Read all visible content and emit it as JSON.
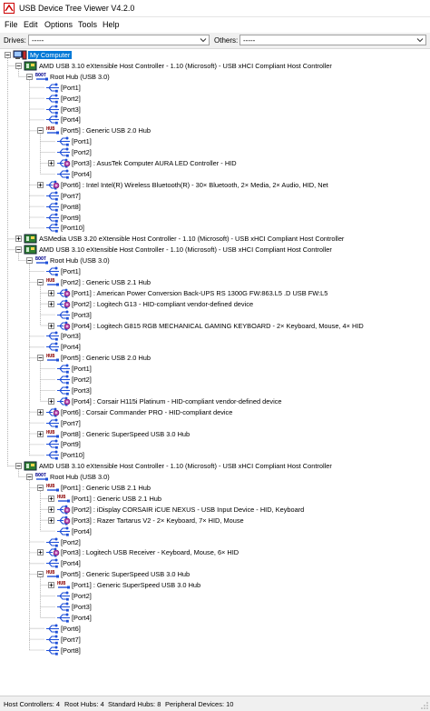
{
  "window": {
    "title": "USB Device Tree Viewer V4.2.0"
  },
  "menu": {
    "file": "File",
    "edit": "Edit",
    "options": "Options",
    "tools": "Tools",
    "help": "Help"
  },
  "toolbar": {
    "drives_label": "Drives:",
    "drives_value": "-----",
    "others_label": "Others:",
    "others_value": "-----"
  },
  "tree": [
    {
      "level": 0,
      "icon": "computer",
      "text": "My Computer",
      "exp": "minus",
      "selected": true
    },
    {
      "level": 1,
      "icon": "controller",
      "text": "AMD USB 3.10 eXtensible Host Controller - 1.10 (Microsoft) - USB xHCI Compliant Host Controller",
      "exp": "minus"
    },
    {
      "level": 2,
      "icon": "boot",
      "text": "Root Hub (USB 3.0)",
      "exp": "minus"
    },
    {
      "level": 3,
      "icon": "port",
      "text": "[Port1]"
    },
    {
      "level": 3,
      "icon": "port",
      "text": "[Port2]"
    },
    {
      "level": 3,
      "icon": "port",
      "text": "[Port3]"
    },
    {
      "level": 3,
      "icon": "port",
      "text": "[Port4]"
    },
    {
      "level": 3,
      "icon": "hub",
      "text": "[Port5] : Generic USB 2.0 Hub",
      "exp": "minus"
    },
    {
      "level": 4,
      "icon": "port",
      "text": "[Port1]"
    },
    {
      "level": 4,
      "icon": "port",
      "text": "[Port2]"
    },
    {
      "level": 4,
      "icon": "device",
      "text": "[Port3] : AsusTek Computer AURA LED Controller - HID",
      "exp": "plus"
    },
    {
      "level": 4,
      "icon": "port",
      "text": "[Port4]"
    },
    {
      "level": 3,
      "icon": "device",
      "text": "[Port6] : Intel Intel(R) Wireless Bluetooth(R) - 30× Bluetooth, 2× Media, 2× Audio, HID, Net",
      "exp": "plus"
    },
    {
      "level": 3,
      "icon": "port",
      "text": "[Port7]"
    },
    {
      "level": 3,
      "icon": "port",
      "text": "[Port8]"
    },
    {
      "level": 3,
      "icon": "port",
      "text": "[Port9]"
    },
    {
      "level": 3,
      "icon": "port",
      "text": "[Port10]"
    },
    {
      "level": 1,
      "icon": "controller",
      "text": "ASMedia USB 3.20 eXtensible Host Controller - 1.10 (Microsoft) - USB xHCI Compliant Host Controller",
      "exp": "plus"
    },
    {
      "level": 1,
      "icon": "controller",
      "text": "AMD USB 3.10 eXtensible Host Controller - 1.10 (Microsoft) - USB xHCI Compliant Host Controller",
      "exp": "minus"
    },
    {
      "level": 2,
      "icon": "boot",
      "text": "Root Hub (USB 3.0)",
      "exp": "minus"
    },
    {
      "level": 3,
      "icon": "port",
      "text": "[Port1]"
    },
    {
      "level": 3,
      "icon": "hub",
      "text": "[Port2] : Generic USB 2.1 Hub",
      "exp": "minus"
    },
    {
      "level": 4,
      "icon": "device",
      "text": "[Port1] : American Power Conversion Back-UPS RS 1300G FW:863.L5 .D USB FW:L5",
      "exp": "plus"
    },
    {
      "level": 4,
      "icon": "device",
      "text": "[Port2] : Logitech G13 - HID-compliant vendor-defined device",
      "exp": "plus"
    },
    {
      "level": 4,
      "icon": "port",
      "text": "[Port3]"
    },
    {
      "level": 4,
      "icon": "device",
      "text": "[Port4] : Logitech G815 RGB MECHANICAL GAMING KEYBOARD - 2× Keyboard, Mouse, 4× HID",
      "exp": "plus"
    },
    {
      "level": 3,
      "icon": "port",
      "text": "[Port3]"
    },
    {
      "level": 3,
      "icon": "port",
      "text": "[Port4]"
    },
    {
      "level": 3,
      "icon": "hub",
      "text": "[Port5] : Generic USB 2.0 Hub",
      "exp": "minus"
    },
    {
      "level": 4,
      "icon": "port",
      "text": "[Port1]"
    },
    {
      "level": 4,
      "icon": "port",
      "text": "[Port2]"
    },
    {
      "level": 4,
      "icon": "port",
      "text": "[Port3]"
    },
    {
      "level": 4,
      "icon": "device",
      "text": "[Port4] : Corsair H115i Platinum - HID-compliant vendor-defined device",
      "exp": "plus"
    },
    {
      "level": 3,
      "icon": "device",
      "text": "[Port6] : Corsair Commander PRO - HID-compliant device",
      "exp": "plus"
    },
    {
      "level": 3,
      "icon": "port",
      "text": "[Port7]"
    },
    {
      "level": 3,
      "icon": "hub",
      "text": "[Port8] : Generic SuperSpeed USB 3.0 Hub",
      "exp": "plus"
    },
    {
      "level": 3,
      "icon": "port",
      "text": "[Port9]"
    },
    {
      "level": 3,
      "icon": "port",
      "text": "[Port10]"
    },
    {
      "level": 1,
      "icon": "controller",
      "text": "AMD USB 3.10 eXtensible Host Controller - 1.10 (Microsoft) - USB xHCI Compliant Host Controller",
      "exp": "minus"
    },
    {
      "level": 2,
      "icon": "boot",
      "text": "Root Hub (USB 3.0)",
      "exp": "minus"
    },
    {
      "level": 3,
      "icon": "hub",
      "text": "[Port1] : Generic USB 2.1 Hub",
      "exp": "minus"
    },
    {
      "level": 4,
      "icon": "hub",
      "text": "[Port1] : Generic USB 2.1 Hub",
      "exp": "plus"
    },
    {
      "level": 4,
      "icon": "device",
      "text": "[Port2] : iDisplay CORSAIR iCUE NEXUS - USB Input Device - HID, Keyboard",
      "exp": "plus"
    },
    {
      "level": 4,
      "icon": "device",
      "text": "[Port3] : Razer Tartarus V2 - 2× Keyboard, 7× HID, Mouse",
      "exp": "plus"
    },
    {
      "level": 4,
      "icon": "port",
      "text": "[Port4]"
    },
    {
      "level": 3,
      "icon": "port",
      "text": "[Port2]"
    },
    {
      "level": 3,
      "icon": "device",
      "text": "[Port3] : Logitech USB Receiver - Keyboard, Mouse, 6× HID",
      "exp": "plus"
    },
    {
      "level": 3,
      "icon": "port",
      "text": "[Port4]"
    },
    {
      "level": 3,
      "icon": "hub",
      "text": "[Port5] : Generic SuperSpeed USB 3.0 Hub",
      "exp": "minus"
    },
    {
      "level": 4,
      "icon": "hub",
      "text": "[Port1] : Generic SuperSpeed USB 3.0 Hub",
      "exp": "plus"
    },
    {
      "level": 4,
      "icon": "port",
      "text": "[Port2]"
    },
    {
      "level": 4,
      "icon": "port",
      "text": "[Port3]"
    },
    {
      "level": 4,
      "icon": "port",
      "text": "[Port4]"
    },
    {
      "level": 3,
      "icon": "port",
      "text": "[Port6]"
    },
    {
      "level": 3,
      "icon": "port",
      "text": "[Port7]"
    },
    {
      "level": 3,
      "icon": "port",
      "text": "[Port8]"
    }
  ],
  "status": {
    "host_controllers": "Host Controllers: 4",
    "root_hubs": "Root Hubs: 4",
    "standard_hubs": "Standard Hubs: 8",
    "peripheral_devices": "Peripheral Devices: 10"
  },
  "colors": {
    "selection": "#0078d7",
    "hub_label": "#8b0000",
    "boot_label": "#00008b",
    "controller_green": "#2e7d32",
    "port_blue": "#1e4fd8"
  }
}
